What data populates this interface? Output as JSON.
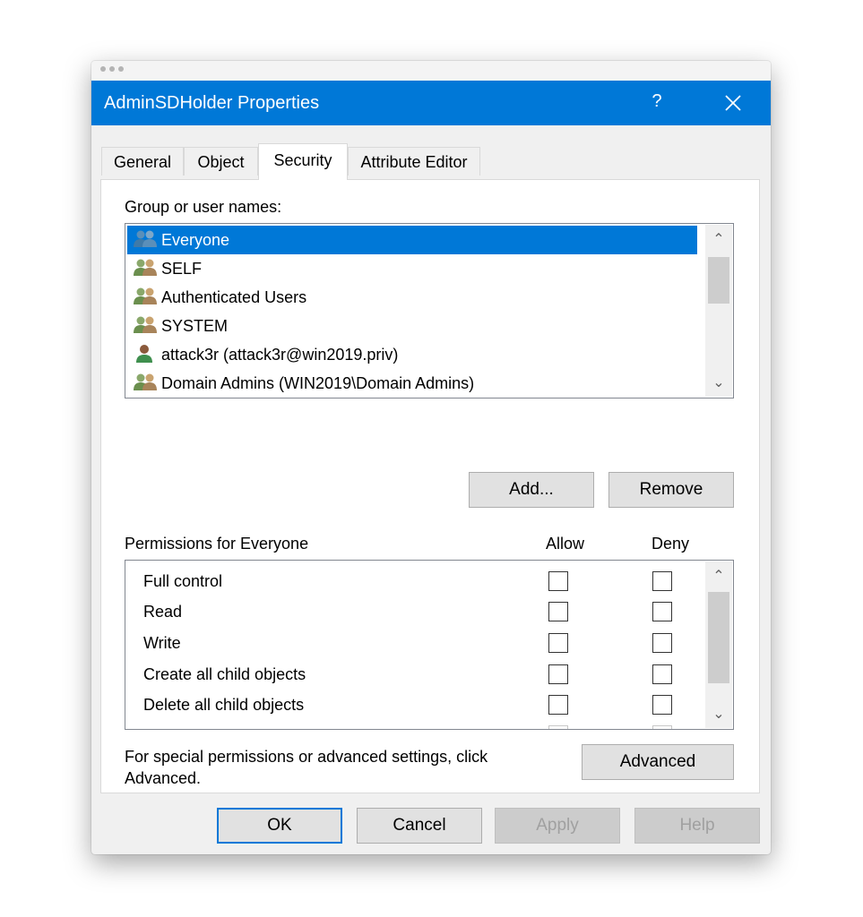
{
  "window": {
    "title": "AdminSDHolder Properties",
    "help_label": "?",
    "title_color": "#0078d7"
  },
  "tabs": [
    {
      "label": "General",
      "active": false
    },
    {
      "label": "Object",
      "active": false
    },
    {
      "label": "Security",
      "active": true
    },
    {
      "label": "Attribute Editor",
      "active": false
    }
  ],
  "security": {
    "group_label": "Group or user names:",
    "principals": [
      {
        "name": "Everyone",
        "icon": "group-icon",
        "selected": true
      },
      {
        "name": "SELF",
        "icon": "group-icon",
        "selected": false
      },
      {
        "name": "Authenticated Users",
        "icon": "group-icon",
        "selected": false
      },
      {
        "name": "SYSTEM",
        "icon": "group-icon",
        "selected": false
      },
      {
        "name": "attack3r (attack3r@win2019.priv)",
        "icon": "user-icon",
        "selected": false
      },
      {
        "name": "Domain Admins (WIN2019\\Domain Admins)",
        "icon": "group-icon",
        "selected": false
      }
    ],
    "add_label": "Add...",
    "remove_label": "Remove",
    "permissions_label": "Permissions for Everyone",
    "allow_label": "Allow",
    "deny_label": "Deny",
    "permissions": [
      {
        "name": "Full control",
        "allow": false,
        "deny": false
      },
      {
        "name": "Read",
        "allow": false,
        "deny": false
      },
      {
        "name": "Write",
        "allow": false,
        "deny": false
      },
      {
        "name": "Create all child objects",
        "allow": false,
        "deny": false
      },
      {
        "name": "Delete all child objects",
        "allow": false,
        "deny": false
      }
    ],
    "advanced_text": "For special permissions or advanced settings, click",
    "advanced_text_2": "Advanced.",
    "advanced_label": "Advanced"
  },
  "footer": {
    "ok_label": "OK",
    "cancel_label": "Cancel",
    "apply_label": "Apply",
    "help_label": "Help"
  }
}
